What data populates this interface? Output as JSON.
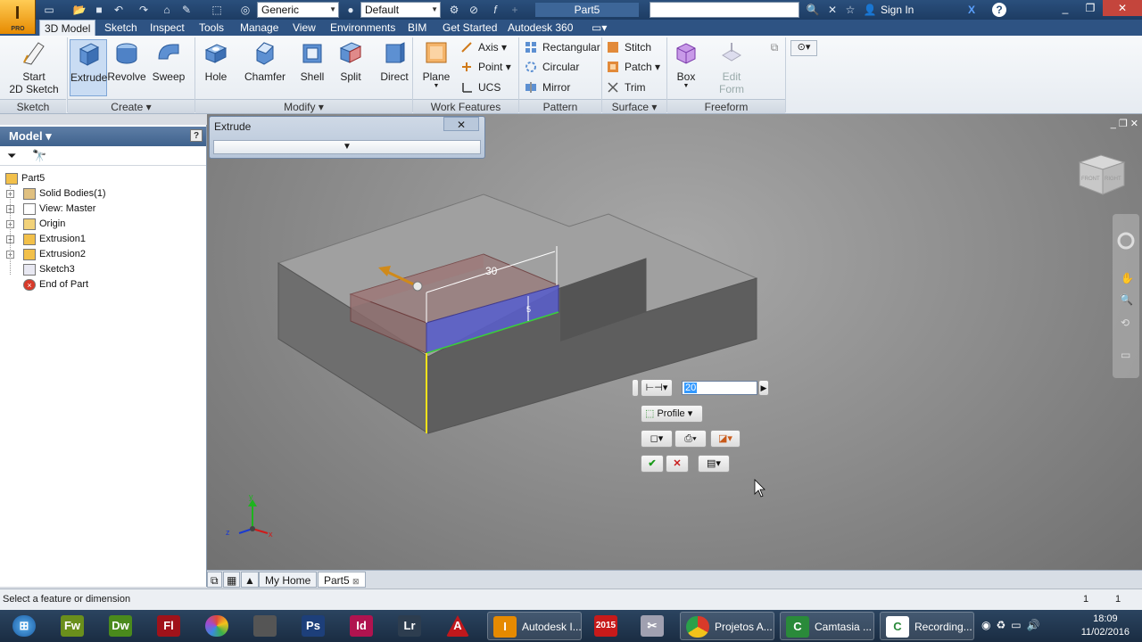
{
  "titlebar": {
    "material": "Generic",
    "appearance": "Default",
    "document": "Part5",
    "signin": "Sign In",
    "help": "?"
  },
  "app_logo": {
    "letter": "I",
    "edition": "PRO"
  },
  "ribbon_tabs": [
    "3D Model",
    "Sketch",
    "Inspect",
    "Tools",
    "Manage",
    "View",
    "Environments",
    "BIM",
    "Get Started",
    "Autodesk 360"
  ],
  "ribbon": {
    "sketch": {
      "start_label": "Start\n2D Sketch",
      "panel": "Sketch"
    },
    "create": {
      "buttons": [
        "Extrude",
        "Revolve",
        "Sweep"
      ],
      "panel": "Create"
    },
    "modify": {
      "buttons": [
        "Hole",
        "Chamfer",
        "Shell",
        "Split",
        "Direct"
      ],
      "panel": "Modify"
    },
    "work_features": {
      "plane": "Plane",
      "axis": "Axis",
      "point": "Point",
      "ucs": "UCS",
      "panel": "Work Features"
    },
    "pattern": {
      "items": [
        "Rectangular",
        "Circular",
        "Mirror"
      ],
      "panel": "Pattern"
    },
    "surface": {
      "items": [
        "Stitch",
        "Patch",
        "Trim"
      ],
      "panel": "Surface"
    },
    "freeform": {
      "box": "Box",
      "edit_form": "Edit\nForm",
      "panel": "Freeform"
    }
  },
  "browser": {
    "title": "Model",
    "help": "?",
    "items": [
      {
        "label": "Part5",
        "icon": "part-icon",
        "level": 0,
        "expand": ""
      },
      {
        "label": "Solid Bodies(1)",
        "icon": "solid-bodies-icon",
        "level": 1,
        "expand": "+"
      },
      {
        "label": "View: Master",
        "icon": "view-icon",
        "level": 1,
        "expand": "+"
      },
      {
        "label": "Origin",
        "icon": "folder-icon",
        "level": 1,
        "expand": "+"
      },
      {
        "label": "Extrusion1",
        "icon": "extrusion-icon",
        "level": 1,
        "expand": "+"
      },
      {
        "label": "Extrusion2",
        "icon": "extrusion-icon",
        "level": 1,
        "expand": "+"
      },
      {
        "label": "Sketch3",
        "icon": "sketch-icon",
        "level": 1,
        "expand": ""
      },
      {
        "label": "End of Part",
        "icon": "end-of-part-icon",
        "level": 1,
        "expand": ""
      }
    ]
  },
  "extrude_dialog": {
    "title": "Extrude",
    "close": "✕"
  },
  "viewport": {
    "dim_length": "30",
    "dim_depth": "5",
    "distance_value": "20",
    "profile_label": "Profile",
    "viewcube_labels": [
      "FRONT",
      "RIGHT"
    ],
    "axes": {
      "x": "x",
      "y": "y",
      "z": "z"
    }
  },
  "doc_tabs": [
    "My Home",
    "Part5"
  ],
  "status": {
    "message": "Select a feature or dimension",
    "count1": "1",
    "count2": "1"
  },
  "taskbar": {
    "apps": [
      {
        "label": "Fw",
        "color": "#6a8f1c"
      },
      {
        "label": "Dw",
        "color": "#4a8a1c"
      },
      {
        "label": "Fl",
        "color": "#a0121a"
      },
      {
        "label": "",
        "color": "#ffffff"
      },
      {
        "label": "",
        "color": "#555555"
      },
      {
        "label": "Ps",
        "color": "#1d3f7a"
      },
      {
        "label": "Id",
        "color": "#b0134f"
      },
      {
        "label": "Lr",
        "color": "#2d3d4f"
      },
      {
        "label": "A",
        "color": "#c0181c"
      }
    ],
    "windows": [
      "Autodesk I...",
      "Projetos A...",
      "Camtasia ...",
      "Recording..."
    ],
    "sw_year": "2015",
    "time": "18:09",
    "date": "11/02/2016"
  }
}
